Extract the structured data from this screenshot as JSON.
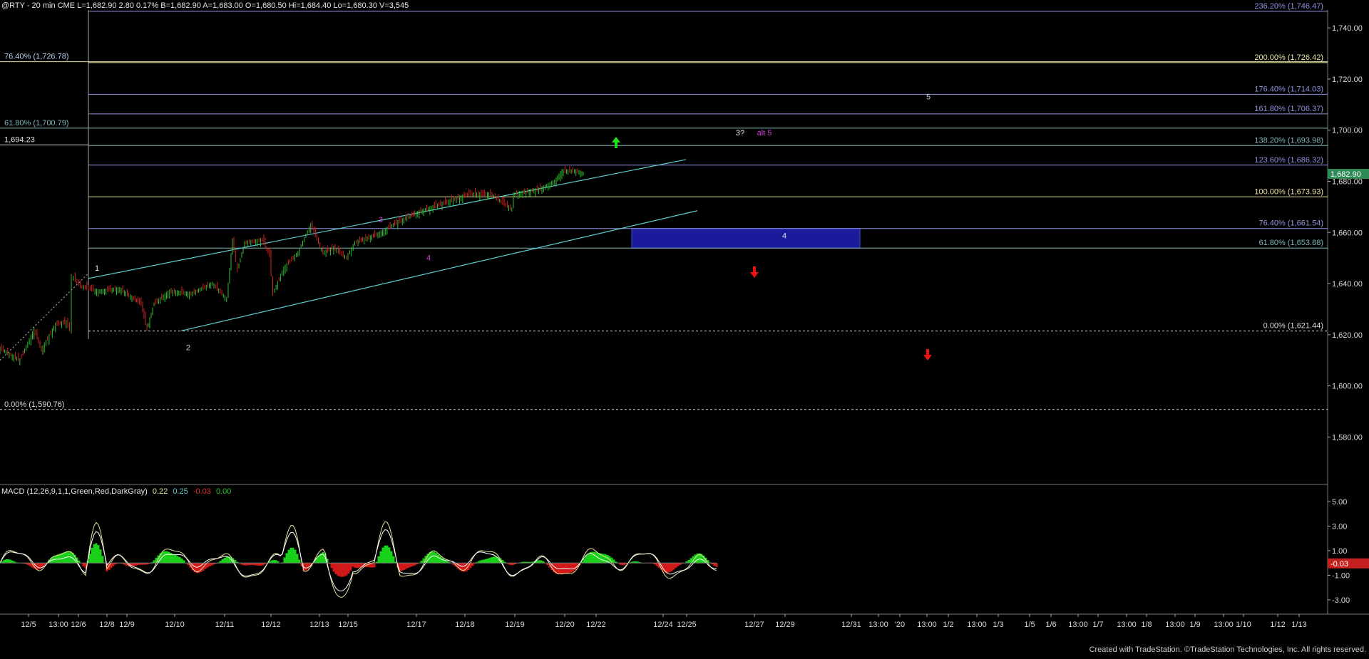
{
  "header": {
    "symbol": "@RTY - 20 min  CME",
    "quote": "L=1,682.90  2.80  0.17%  B=1,682.90  A=1,683.00  O=1,680.50  Hi=1,684.40  Lo=1,680.30  V=3,545"
  },
  "macd": {
    "title": "MACD (12,26,9,1,1,Green,Red,DarkGray)",
    "v1": "0.22",
    "v2": "0.25",
    "v3": "-0.03",
    "v4": "0.00",
    "current_label": "-0.03",
    "ticks": [
      "5.00",
      "3.00",
      "1.00",
      "-1.00",
      "-3.00"
    ]
  },
  "footer": "Created with TradeStation. ©TradeStation Technologies, Inc. All rights reserved.",
  "colors": {
    "background": "#000000",
    "price_up": "#2fbf2f",
    "price_down": "#d21f1f",
    "fib_yellow": "#e8e3a0",
    "fib_blue": "#8f93e0",
    "fib_teal": "#7fb5b5",
    "channel": "#5ecfcf",
    "zone": "#1a1a9a"
  },
  "chart_data": [
    {
      "type": "candlestick",
      "title": "@RTY - 20 min",
      "yticks": [
        "1,740.00",
        "1,720.00",
        "1,700.00",
        "1,680.00",
        "1,660.00",
        "1,640.00",
        "1,620.00",
        "1,600.00",
        "1,580.00"
      ],
      "ylim": [
        1562,
        1747
      ],
      "current_price": "1,682.90",
      "xticks": [
        "12/5",
        "13:00",
        "12/6",
        "12/8",
        "12/9",
        "12/10",
        "12/11",
        "12/12",
        "12/13",
        "12/15",
        "12/17",
        "12/18",
        "12/19",
        "12/20",
        "12/22",
        "12/24",
        "12/25",
        "12/27",
        "12/29",
        "12/31",
        "13:00",
        "'20",
        "13:00",
        "1/2",
        "13:00",
        "1/3",
        "1/5",
        "1/6",
        "13:00",
        "1/7",
        "13:00",
        "1/8",
        "13:00",
        "1/9",
        "13:00",
        "1/10",
        "1/12",
        "1/13"
      ],
      "price_path": [
        [
          0,
          1615
        ],
        [
          30,
          1610
        ],
        [
          50,
          1622
        ],
        [
          60,
          1614
        ],
        [
          80,
          1624
        ],
        [
          95,
          1625
        ],
        [
          100,
          1622
        ],
        [
          103,
          1643
        ],
        [
          115,
          1639
        ],
        [
          140,
          1637
        ],
        [
          170,
          1638
        ],
        [
          200,
          1632
        ],
        [
          208,
          1622
        ],
        [
          218,
          1632
        ],
        [
          240,
          1637
        ],
        [
          270,
          1636
        ],
        [
          300,
          1640
        ],
        [
          320,
          1634
        ],
        [
          328,
          1657
        ],
        [
          335,
          1645
        ],
        [
          345,
          1656
        ],
        [
          370,
          1657
        ],
        [
          380,
          1651
        ],
        [
          385,
          1636
        ],
        [
          400,
          1646
        ],
        [
          420,
          1652
        ],
        [
          438,
          1663
        ],
        [
          455,
          1652
        ],
        [
          470,
          1654
        ],
        [
          488,
          1650
        ],
        [
          500,
          1656
        ],
        [
          530,
          1659
        ],
        [
          560,
          1664
        ],
        [
          590,
          1668
        ],
        [
          620,
          1671
        ],
        [
          660,
          1675
        ],
        [
          690,
          1675
        ],
        [
          720,
          1669
        ],
        [
          722,
          1675
        ],
        [
          760,
          1677
        ],
        [
          780,
          1680
        ],
        [
          790,
          1684
        ],
        [
          810,
          1684
        ],
        [
          820,
          1683
        ]
      ],
      "fib_lines": [
        {
          "label": "236.20% (1,746.47)",
          "value": 1746.47,
          "color": "fib_blue"
        },
        {
          "label": "200.00% (1,726.42)",
          "value": 1726.42,
          "color": "fib_yellow"
        },
        {
          "label": "176.40% (1,714.03)",
          "value": 1714.03,
          "color": "fib_blue"
        },
        {
          "label": "161.80% (1,706.37)",
          "value": 1706.37,
          "color": "fib_blue"
        },
        {
          "label": "138.20% (1,693.98)",
          "value": 1693.98,
          "color": "fib_teal"
        },
        {
          "label": "123.60% (1,686.32)",
          "value": 1686.32,
          "color": "fib_blue"
        },
        {
          "label": "100.00% (1,673.93)",
          "value": 1673.93,
          "color": "fib_yellow"
        },
        {
          "label": "76.40% (1,661.54)",
          "value": 1661.54,
          "color": "fib_blue"
        },
        {
          "label": "61.80% (1,653.88)",
          "value": 1653.88,
          "color": "fib_teal"
        },
        {
          "label": "0.00% (1,621.44)",
          "value": 1621.44,
          "color": "white_dotted"
        }
      ],
      "left_fib_labels": [
        {
          "label": "76.40% (1,726.78)",
          "value": 1726.78
        },
        {
          "label": "61.80% (1,700.79)",
          "value": 1700.79
        },
        {
          "label": "1,694.23",
          "value": 1694.23
        },
        {
          "label": "0.00% (1,590.76)",
          "value": 1590.76
        }
      ],
      "wave_labels": [
        "1",
        "2",
        "3",
        "4",
        "3?",
        "alt 5",
        "4",
        "5"
      ],
      "target_zone": {
        "label": "4",
        "low": 1653.88,
        "high": 1661.54
      }
    },
    {
      "type": "line",
      "title": "MACD (12,26,9,1,1,Green,Red,DarkGray)",
      "ylim": [
        -4.6,
        6.2
      ],
      "yticks": [
        "5.00",
        "3.00",
        "1.00",
        "-1.00",
        "-3.00"
      ]
    }
  ]
}
